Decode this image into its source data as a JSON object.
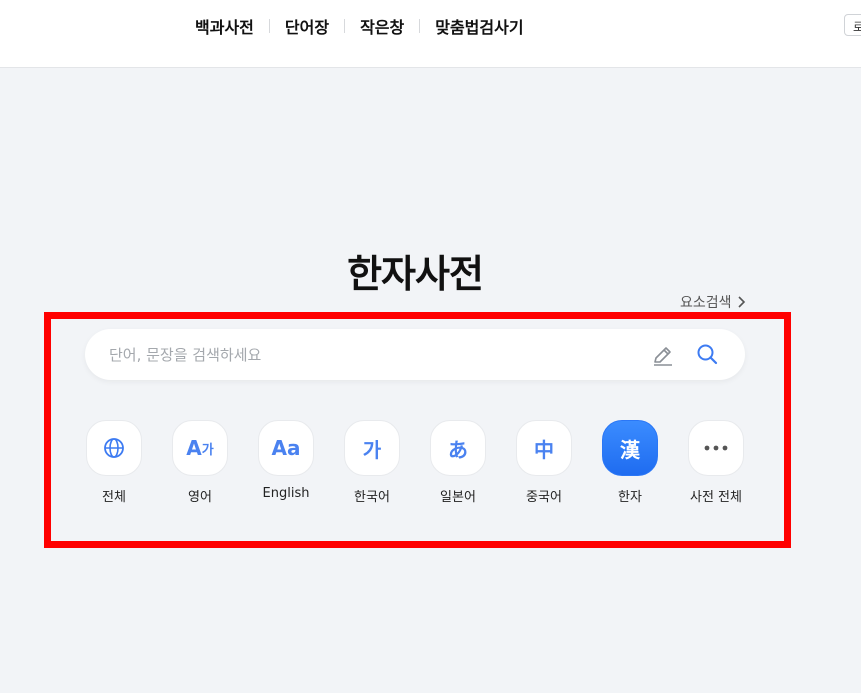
{
  "topnav": {
    "items": [
      {
        "label": "백과사전"
      },
      {
        "label": "단어장"
      },
      {
        "label": "작은창"
      },
      {
        "label": "맞춤법검사기"
      }
    ],
    "login_partial": "로"
  },
  "title": "한자사전",
  "element_search": {
    "label": "요소검색"
  },
  "search": {
    "placeholder": "단어, 문장을 검색하세요",
    "value": ""
  },
  "dictionaries": [
    {
      "label": "전체",
      "icon": "globe-icon",
      "glyph": ""
    },
    {
      "label": "영어",
      "icon": "english-ko-icon",
      "glyph": "A",
      "glyph_small": "가"
    },
    {
      "label": "English",
      "icon": "aa-icon",
      "glyph": "Aa"
    },
    {
      "label": "한국어",
      "icon": "hangul-icon",
      "glyph": "가"
    },
    {
      "label": "일본어",
      "icon": "hiragana-icon",
      "glyph": "あ"
    },
    {
      "label": "중국어",
      "icon": "chinese-icon",
      "glyph": "中"
    },
    {
      "label": "한자",
      "icon": "hanja-icon",
      "glyph": "漢",
      "active": true
    },
    {
      "label": "사전 전체",
      "icon": "more-icon",
      "glyph": ""
    }
  ],
  "colors": {
    "accent": "#2b77f6",
    "highlight": "#ff0000",
    "background": "#f2f4f7"
  }
}
